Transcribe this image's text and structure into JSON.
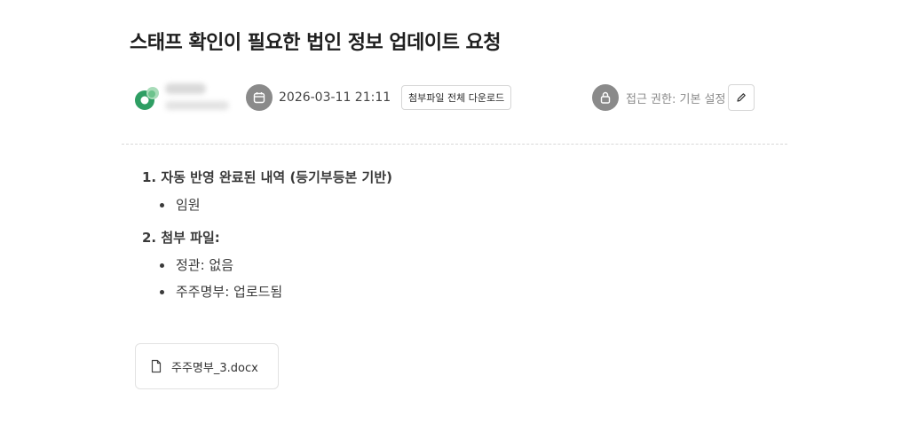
{
  "document": {
    "title": "스태프 확인이 필요한 법인 정보 업데이트 요청"
  },
  "meta": {
    "avatar_icon": "avatar-logo-icon",
    "date_icon": "calendar-icon",
    "date": "2026-03-11 21:11",
    "download_all_label": "첨부파일 전체 다운로드",
    "lock_icon": "lock-icon",
    "access_label": "접근 권한: 기본 설정",
    "edit_icon": "pencil-icon"
  },
  "body": {
    "sections": [
      {
        "heading": "1. 자동 반영 완료된 내역 (등기부등본 기반)",
        "items": [
          "임원"
        ]
      },
      {
        "heading": "2. 첨부 파일:",
        "items": [
          "정관: 없음",
          "주주명부: 업로드됨"
        ]
      }
    ]
  },
  "attachment": {
    "icon": "file-icon",
    "filename": "주주명부_3.docx"
  },
  "colors": {
    "brand_green": "#2e9e63",
    "icon_gray": "#8a8a8a",
    "border": "#d6d6d6"
  }
}
